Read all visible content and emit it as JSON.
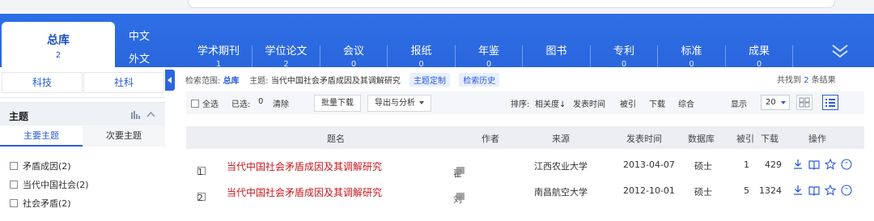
{
  "nav": {
    "total": {
      "label": "总库",
      "count": "2"
    },
    "lang_cn": "中文",
    "lang_foreign": "外文",
    "categories": [
      {
        "label": "学术期刊",
        "count": "1",
        "caret": true
      },
      {
        "label": "学位论文",
        "count": "2",
        "caret": true
      },
      {
        "label": "会议",
        "count": "0",
        "caret": true
      },
      {
        "label": "报纸",
        "count": "0",
        "caret": false
      },
      {
        "label": "年鉴",
        "count": "0",
        "caret": false
      },
      {
        "label": "图书",
        "count": "",
        "caret": true
      },
      {
        "label": "专利",
        "count": "0",
        "caret": true
      },
      {
        "label": "标准",
        "count": "0",
        "caret": true
      },
      {
        "label": "成果",
        "count": "0",
        "caret": true
      }
    ]
  },
  "sidebar": {
    "tab_sci": "科技",
    "tab_social": "社科",
    "panel_title": "主题",
    "subtab_main": "主要主题",
    "subtab_secondary": "次要主题",
    "facets": [
      "矛盾成因(2)",
      "当代中国社会(2)",
      "社会矛盾(2)"
    ]
  },
  "scope": {
    "label": "检索范围:",
    "range": "总库",
    "topic_label": "主题:",
    "topic": "当代中国社会矛盾成因及其调解研究",
    "custom": "主题定制",
    "history": "检索历史",
    "found_pre": "共找到",
    "found_num": "2",
    "found_post": "条结果"
  },
  "toolbar": {
    "select_all": "全选",
    "selected_label": "已选:",
    "selected_count": "0",
    "clear": "清除",
    "batch_download": "批量下载",
    "export": "导出与分析",
    "sort_label": "排序:",
    "sort_relevance": "相关度",
    "sort_date": "发表时间",
    "sort_cited": "被引",
    "sort_download": "下载",
    "sort_composite": "综合",
    "show_label": "显示",
    "per_page": "20"
  },
  "table": {
    "headers": {
      "title": "题名",
      "author": "作者",
      "source": "来源",
      "date": "发表时间",
      "db": "数据库",
      "cited": "被引",
      "downloads": "下载",
      "ops": "操作"
    },
    "rows": [
      {
        "index": "1",
        "title": "当代中国社会矛盾成因及其调解研究",
        "author": "翟",
        "source": "江西农业大学",
        "date": "2013-04-07",
        "db": "硕士",
        "cited": "1",
        "downloads": "429"
      },
      {
        "index": "2",
        "title": "当代中国社会矛盾成因及其调解研究",
        "author": "刘",
        "source": "南昌航空大学",
        "date": "2012-10-01",
        "db": "硕士",
        "cited": "5",
        "downloads": "1324"
      }
    ]
  },
  "colors": {
    "nav_blue": "#2a66dd",
    "link_blue": "#2a5bd7",
    "title_red": "#c8161d"
  }
}
